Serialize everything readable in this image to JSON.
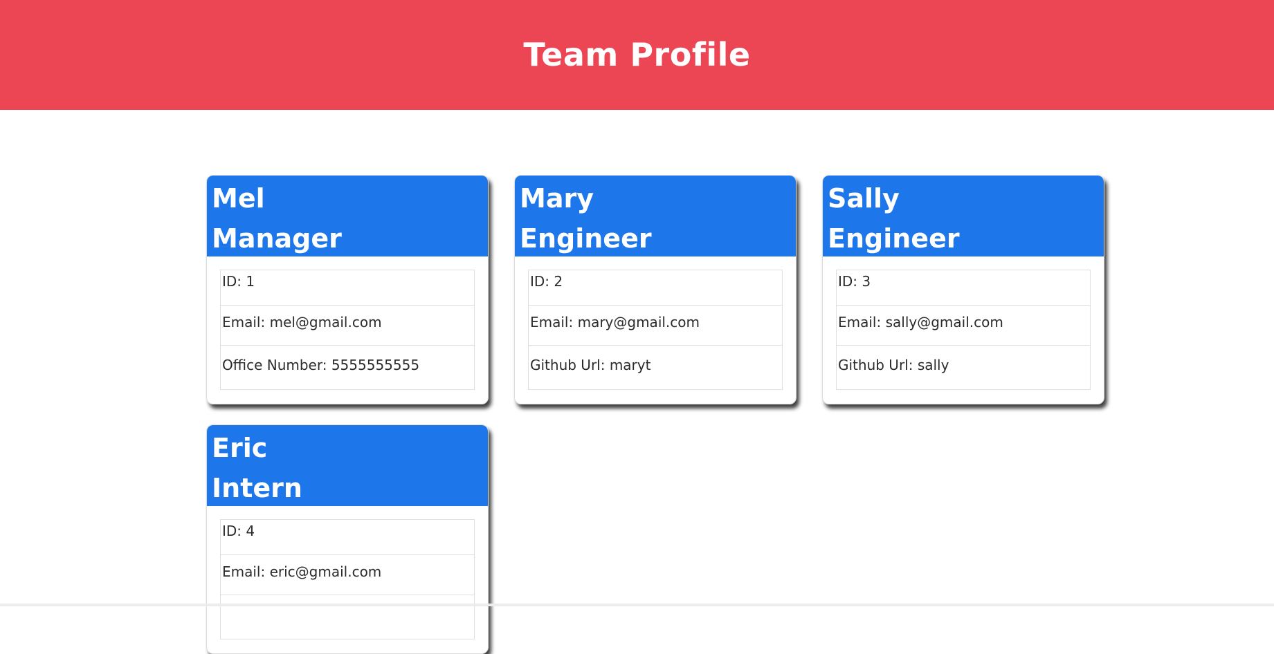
{
  "header": {
    "title": "Team Profile"
  },
  "colors": {
    "header_bg": "#ec4553",
    "card_head_bg": "#1e77ea"
  },
  "employees": [
    {
      "name": "Mel",
      "role": "Manager",
      "id": "ID: 1",
      "email": "Email: mel@gmail.com",
      "extra": "Office Number: 5555555555"
    },
    {
      "name": "Mary",
      "role": "Engineer",
      "id": "ID: 2",
      "email": "Email: mary@gmail.com",
      "extra": "Github Url: maryt"
    },
    {
      "name": "Sally",
      "role": "Engineer",
      "id": "ID: 3",
      "email": "Email: sally@gmail.com",
      "extra": "Github Url: sally"
    },
    {
      "name": "Eric",
      "role": "Intern",
      "id": "ID: 4",
      "email": "Email: eric@gmail.com",
      "extra": ""
    }
  ]
}
